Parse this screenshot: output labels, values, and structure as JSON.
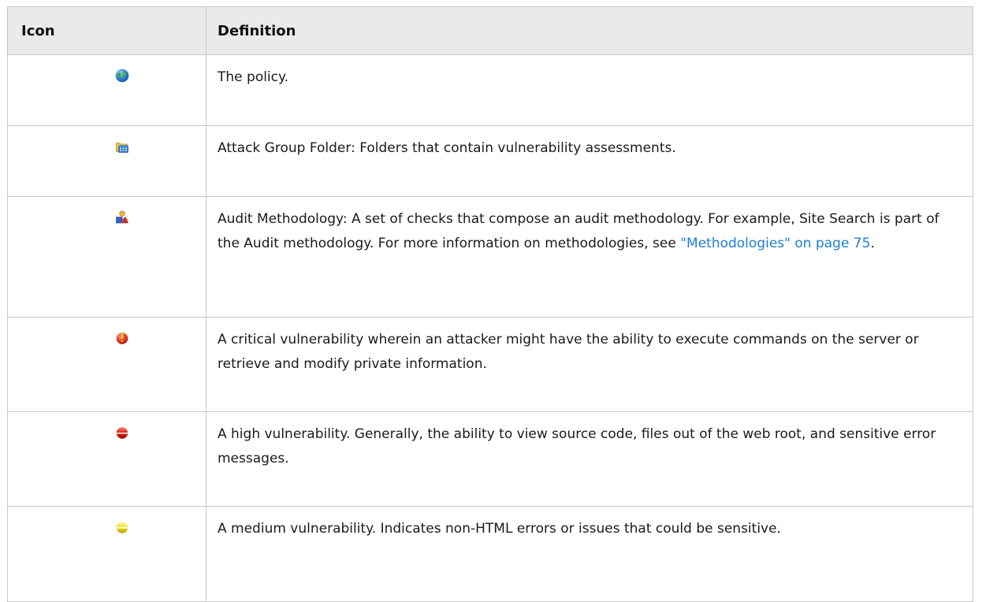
{
  "table": {
    "headers": {
      "icon": "Icon",
      "definition": "Definition"
    },
    "rows": [
      {
        "icon": "globe-icon",
        "text": "The policy."
      },
      {
        "icon": "attack-group-folder-icon",
        "text": "Attack Group Folder: Folders that contain vulnerability assessments."
      },
      {
        "icon": "audit-methodology-icon",
        "text_before": "Audit Methodology: A set of checks that compose an audit methodology. For example, Site Search is part of the Audit methodology. For more information on methodologies, see ",
        "link": "\"Methodologies\" on page 75",
        "text_after": "."
      },
      {
        "icon": "critical-vulnerability-icon",
        "text": "A critical vulnerability wherein an attacker might have the ability to execute commands on the server or retrieve and modify private information."
      },
      {
        "icon": "high-vulnerability-icon",
        "text": "A high vulnerability. Generally, the ability to view source code, files out of the web root, and sensitive error messages."
      },
      {
        "icon": "medium-vulnerability-icon",
        "text": "A medium vulnerability. Indicates non-HTML errors or issues that could be sensitive."
      }
    ]
  },
  "colors": {
    "link": "#1e7fd2",
    "header_bg": "#eaeaea",
    "border": "#c9c9c9"
  }
}
